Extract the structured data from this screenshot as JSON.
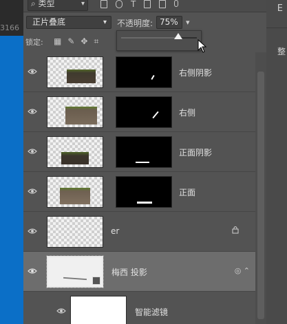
{
  "left_strip": {
    "number_text": "3166"
  },
  "right_strip": {
    "top_label": "E",
    "side_label": "整"
  },
  "filter": {
    "label": "类型",
    "prefix_icon": "search-icon"
  },
  "blend": {
    "mode": "正片叠底"
  },
  "opacity": {
    "label": "不透明度:",
    "value": "75%",
    "level_fraction": 0.75
  },
  "lock": {
    "label": "锁定:"
  },
  "layers": [
    {
      "name": "右侧阴影",
      "visible": true,
      "has_mask": true
    },
    {
      "name": "右侧",
      "visible": true,
      "has_mask": true
    },
    {
      "name": "正面阴影",
      "visible": true,
      "has_mask": true
    },
    {
      "name": "正面",
      "visible": true,
      "has_mask": true
    },
    {
      "name": "er",
      "visible": true,
      "has_mask": false,
      "locked": true
    },
    {
      "name": "梅西 投影",
      "visible": true,
      "has_mask": false,
      "selected": true,
      "smart_object": true
    },
    {
      "name": "智能滤镜",
      "visible": true,
      "has_mask": false,
      "sub": true
    }
  ],
  "colors": {
    "panel_bg": "#535353",
    "selected_bg": "#6d6d6d",
    "canvas_blue": "#0b6fc7"
  }
}
